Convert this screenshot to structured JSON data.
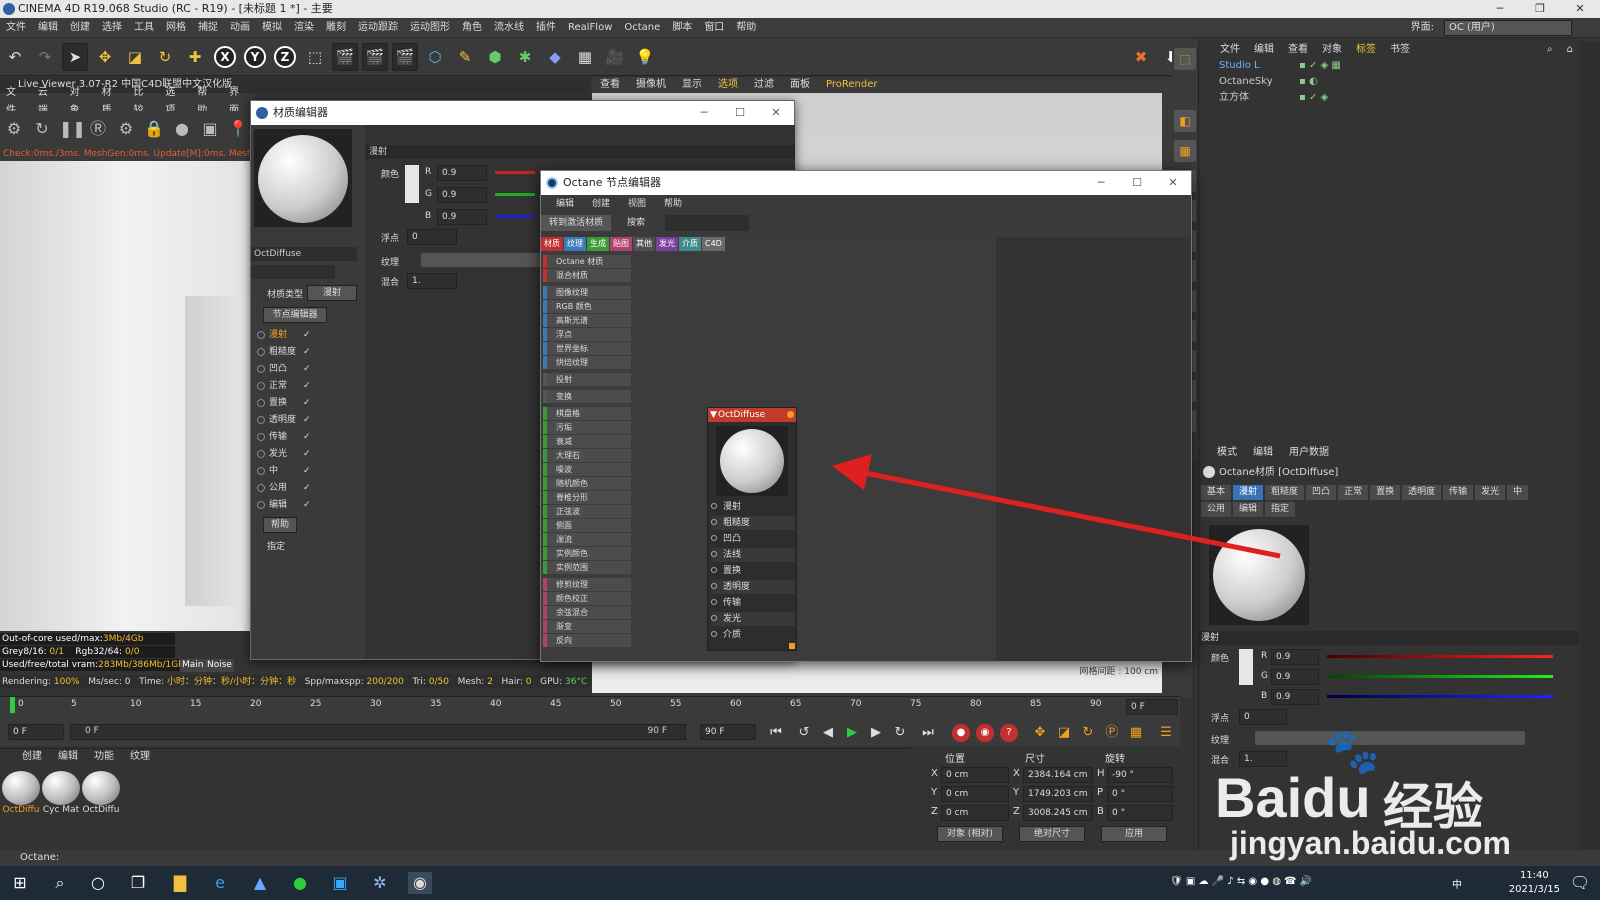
{
  "app": {
    "title": "CINEMA 4D R19.068 Studio (RC - R19) - [未标题 1 *] - 主要",
    "ui_label": "界面:",
    "ui_layout": "OC (用户)"
  },
  "menubar": [
    "文件",
    "编辑",
    "创建",
    "选择",
    "工具",
    "网格",
    "捕捉",
    "动画",
    "模拟",
    "渲染",
    "雕刻",
    "运动跟踪",
    "运动图形",
    "角色",
    "流水线",
    "插件",
    "RealFlow",
    "Octane",
    "脚本",
    "窗口",
    "帮助"
  ],
  "toolbar": {
    "x": "X",
    "y": "Y",
    "z": "Z"
  },
  "live_viewer": {
    "title": "Live Viewer 3.07-R2 中国C4D联盟中文汉化版",
    "menu": [
      "文件",
      "云端",
      "对象",
      "材质",
      "比较",
      "选项",
      "帮助",
      "界面"
    ],
    "status": "Check:0ms./3ms. MeshGen:0ms. Update[M]:0ms. Mesh:1"
  },
  "render_info": {
    "line1_label": "Out-of-core used/max:",
    "line1_value": "3Mb/4Gb",
    "line2_label": "Grey8/16:",
    "line2_value": "0/1",
    "line2b_label": "Rgb32/64:",
    "line2b_value": "0/0",
    "line3_label": "Used/free/total vram:",
    "line3_value": "283Mb/386Mb/1Gb",
    "tag_main": "Main",
    "tag_noise": "Noise"
  },
  "statusline": {
    "rendering": "Rendering:",
    "rendering_v": "100%",
    "mssec": "Ms/sec:",
    "mssec_v": "0",
    "time": "Time:",
    "time_v": "小时：分钟：秒/小时：分钟：秒",
    "spp": "Spp/maxspp:",
    "spp_v": "200/200",
    "tri": "Tri:",
    "tri_v": "0/50",
    "mesh": "Mesh:",
    "mesh_v": "2",
    "hair": "Hair:",
    "hair_v": "0",
    "gpu": "GPU:",
    "gpu_v": "36°C"
  },
  "viewport_right": {
    "menu": [
      "查看",
      "摄像机",
      "显示",
      "选项",
      "过滤",
      "面板",
      "ProRender"
    ],
    "grid": "网格间距 : 100 cm"
  },
  "timeline": {
    "ticks": [
      "0",
      "5",
      "10",
      "15",
      "20",
      "25",
      "30",
      "35",
      "40",
      "45",
      "50",
      "55",
      "60",
      "65",
      "70",
      "75",
      "80",
      "85",
      "90"
    ],
    "current": "0 F",
    "start": "0 F",
    "range_start": "0 F",
    "range_end": "90 F",
    "end": "90 F"
  },
  "material_manager": {
    "menu": [
      "创建",
      "编辑",
      "功能",
      "纹理"
    ],
    "materials": [
      {
        "name": "OctDiffu"
      },
      {
        "name": "Cyc Mat"
      },
      {
        "name": "OctDiffu"
      }
    ]
  },
  "coordinates": {
    "headers": {
      "pos": "位置",
      "size": "尺寸",
      "rot": "旋转"
    },
    "rows": [
      {
        "axis": "X",
        "pos": "0 cm",
        "size_axis": "X",
        "size": "2384.164 cm",
        "rot_axis": "H",
        "rot": "-90 °"
      },
      {
        "axis": "Y",
        "pos": "0 cm",
        "size_axis": "Y",
        "size": "1749.203 cm",
        "rot_axis": "P",
        "rot": "0 °"
      },
      {
        "axis": "Z",
        "pos": "0 cm",
        "size_axis": "Z",
        "size": "3008.245 cm",
        "rot_axis": "B",
        "rot": "0 °"
      }
    ],
    "mode1": "对象 (相对)",
    "mode2": "绝对尺寸",
    "apply": "应用"
  },
  "object_manager": {
    "menu": [
      "文件",
      "编辑",
      "查看",
      "对象",
      "标签",
      "书签"
    ],
    "objects": [
      {
        "name": "Studio L"
      },
      {
        "name": "OctaneSky"
      },
      {
        "name": "立方体"
      }
    ]
  },
  "attribute_manager": {
    "menu": [
      "模式",
      "编辑",
      "用户数据"
    ],
    "title": "Octane材质 [OctDiffuse]",
    "tabs1": [
      "基本",
      "漫射",
      "粗糙度",
      "凹凸",
      "正常",
      "置换",
      "透明度",
      "传输",
      "发光",
      "中"
    ],
    "tabs2": [
      "公用",
      "编辑",
      "指定"
    ],
    "section": "漫射",
    "color_label": "颜色",
    "r_label": "R",
    "r": "0.9",
    "g_label": "G",
    "g": "0.9",
    "b_label": "B",
    "b": "0.9",
    "float_label": "浮点",
    "float": "0",
    "texture_label": "纹理",
    "mix_label": "混合",
    "mix": "1."
  },
  "material_editor": {
    "title": "材质编辑器",
    "name": "OctDiffuse",
    "type_label": "材质类型",
    "type": "漫射",
    "node_btn": "节点编辑器",
    "channels": [
      "漫射",
      "粗糙度",
      "凹凸",
      "正常",
      "置换",
      "透明度",
      "传输",
      "发光",
      "中",
      "公用",
      "编辑"
    ],
    "help": "帮助",
    "assign": "指定",
    "section": "漫射",
    "color_label": "颜色",
    "r_label": "R",
    "r": "0.9",
    "g_label": "G",
    "g": "0.9",
    "b_label": "B",
    "b": "0.9",
    "float_label": "浮点",
    "float": "0",
    "texture_label": "纹理",
    "mix_label": "混合",
    "mix": "1."
  },
  "node_editor": {
    "title": "Octane 节点编辑器",
    "menu": [
      "编辑",
      "创建",
      "视图",
      "帮助"
    ],
    "goto_btn": "转到激活材质",
    "search_btn": "搜索",
    "categories": [
      {
        "label": "材质",
        "color": "#c03030"
      },
      {
        "label": "纹理",
        "color": "#3a7ab5"
      },
      {
        "label": "生成",
        "color": "#3a9a3a"
      },
      {
        "label": "贴图",
        "color": "#b04070"
      },
      {
        "label": "其他",
        "color": "#505050"
      },
      {
        "label": "发光",
        "color": "#7a40a0"
      },
      {
        "label": "介质",
        "color": "#408a8a"
      },
      {
        "label": "C4D",
        "color": "#6a6a6a"
      }
    ],
    "items": [
      {
        "label": "Octane 材质",
        "color": "#c03030"
      },
      {
        "label": "混合材质",
        "color": "#c03030"
      },
      {
        "label": "图像纹理",
        "color": "#3a7ab5"
      },
      {
        "label": "RGB 颜色",
        "color": "#3a7ab5"
      },
      {
        "label": "高斯光谱",
        "color": "#3a7ab5"
      },
      {
        "label": "浮点",
        "color": "#3a7ab5"
      },
      {
        "label": "世界坐标",
        "color": "#3a7ab5"
      },
      {
        "label": "烘焙纹理",
        "color": "#3a7ab5"
      },
      {
        "label": "投射",
        "color": "#555555"
      },
      {
        "label": "变换",
        "color": "#555555"
      },
      {
        "label": "棋盘格",
        "color": "#3a9a3a"
      },
      {
        "label": "污垢",
        "color": "#3a9a3a"
      },
      {
        "label": "衰减",
        "color": "#3a9a3a"
      },
      {
        "label": "大理石",
        "color": "#3a9a3a"
      },
      {
        "label": "噪波",
        "color": "#3a9a3a"
      },
      {
        "label": "随机颜色",
        "color": "#3a9a3a"
      },
      {
        "label": "脊椎分形",
        "color": "#3a9a3a"
      },
      {
        "label": "正弦波",
        "color": "#3a9a3a"
      },
      {
        "label": "侧面",
        "color": "#3a9a3a"
      },
      {
        "label": "湍流",
        "color": "#3a9a3a"
      },
      {
        "label": "实例颜色",
        "color": "#3a9a3a"
      },
      {
        "label": "实例范围",
        "color": "#3a9a3a"
      },
      {
        "label": "修剪纹理",
        "color": "#b04070"
      },
      {
        "label": "颜色校正",
        "color": "#b04070"
      },
      {
        "label": "余弦混合",
        "color": "#b04070"
      },
      {
        "label": "渐变",
        "color": "#b04070"
      },
      {
        "label": "反向",
        "color": "#b04070"
      }
    ],
    "node": {
      "title": "OctDiffuse",
      "pins": [
        "漫射",
        "粗糙度",
        "凹凸",
        "法线",
        "置换",
        "透明度",
        "传输",
        "发光",
        "介质"
      ]
    }
  },
  "bottom_status": "Octane:",
  "taskbar": {
    "time": "11:40",
    "date": "2021/3/15",
    "ime": "中"
  },
  "watermark": {
    "text1": "Baidu",
    "text2": "经验",
    "url": "jingyan.baidu.com"
  },
  "colors": {
    "accent": "#f0a020",
    "select_blue": "#3a73b5",
    "arrow": "#e02020"
  }
}
